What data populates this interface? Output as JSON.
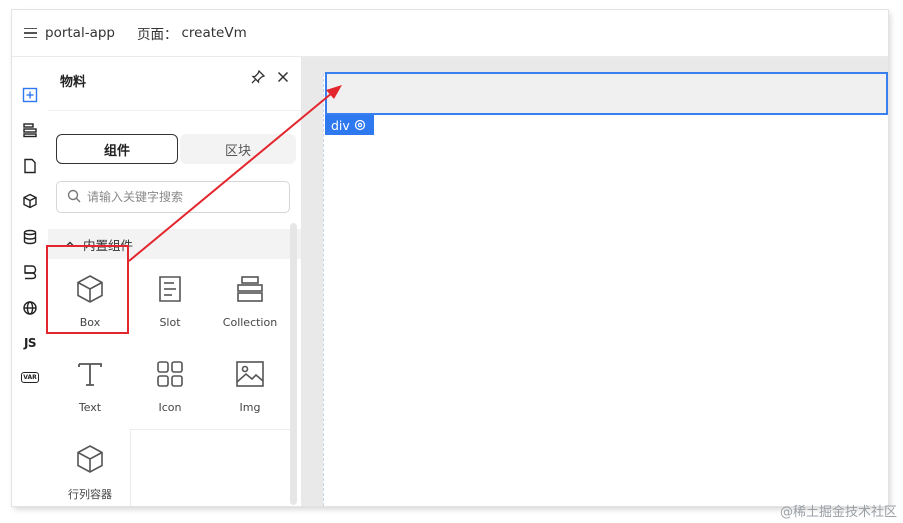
{
  "topbar": {
    "app_name": "portal-app",
    "page_label": "页面：",
    "page_name": "createVm"
  },
  "rail": {
    "items": [
      "add-icon",
      "tree-icon",
      "page-icon",
      "block-icon",
      "datasource-icon",
      "bridge-icon",
      "globe-icon",
      "js",
      "var"
    ],
    "js_label": "JS",
    "var_label": "VAR"
  },
  "panel": {
    "title": "物料",
    "tabs": [
      {
        "label": "组件",
        "active": true
      },
      {
        "label": "区块",
        "active": false
      }
    ],
    "search_placeholder": "请输入关键字搜索",
    "section_label": "内置组件",
    "components": [
      {
        "label": "Box",
        "icon": "box-icon"
      },
      {
        "label": "Slot",
        "icon": "slot-icon"
      },
      {
        "label": "Collection",
        "icon": "collection-icon"
      },
      {
        "label": "Text",
        "icon": "text-icon"
      },
      {
        "label": "Icon",
        "icon": "grid-icon"
      },
      {
        "label": "Img",
        "icon": "image-icon"
      },
      {
        "label": "行列容器",
        "icon": "box-icon"
      }
    ]
  },
  "canvas": {
    "tag_label": "div"
  },
  "watermark": "@稀土掘金技术社区",
  "colors": {
    "accent": "#2f79f0",
    "highlight": "#e3262e",
    "canvas_bg": "#e9e9e9"
  }
}
